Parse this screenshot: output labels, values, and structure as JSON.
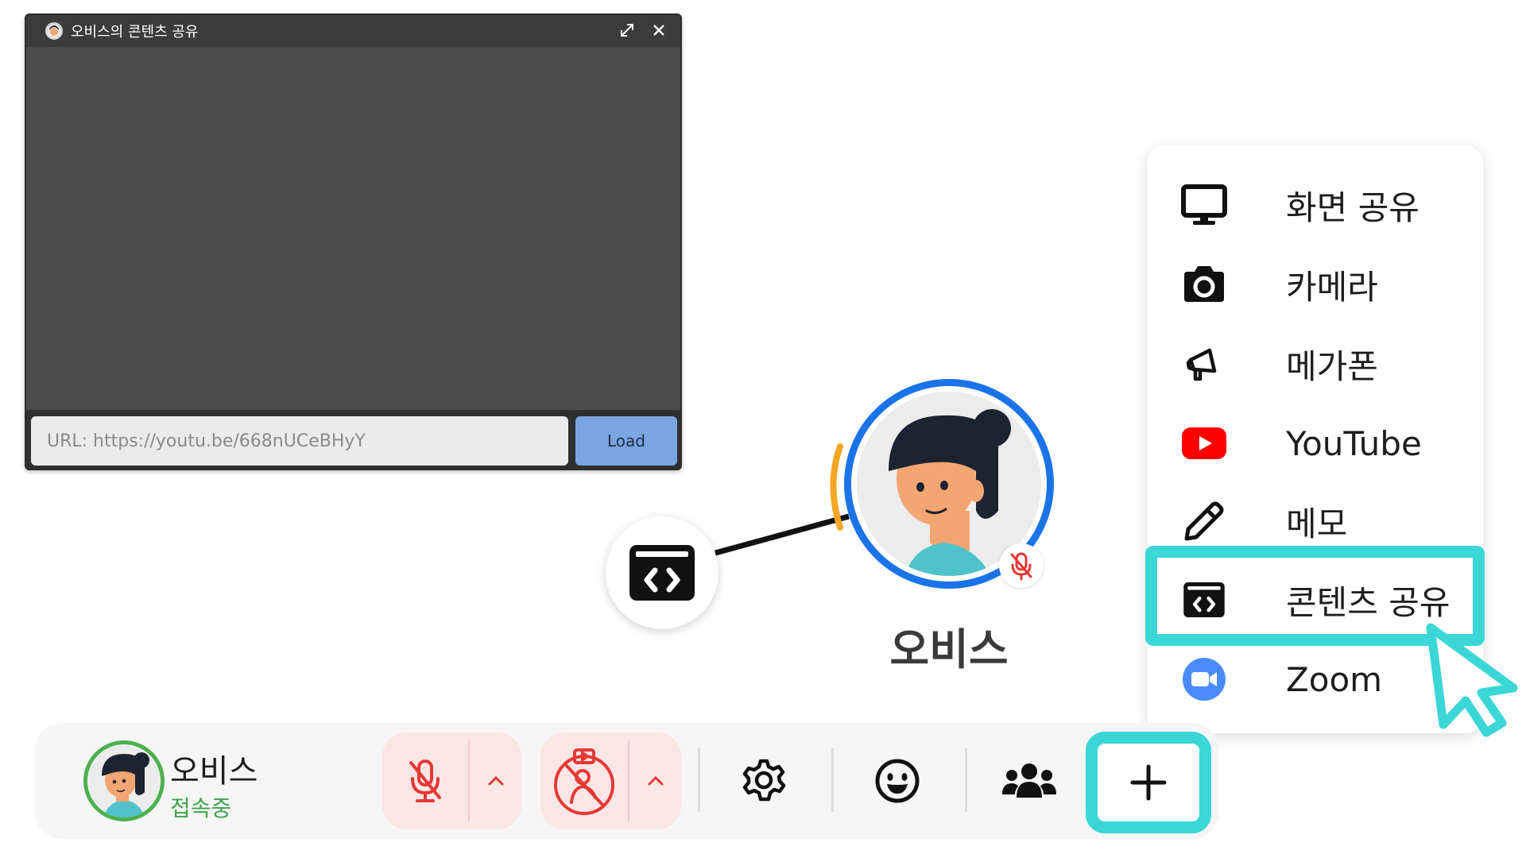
{
  "share_window": {
    "title": "오비스의 콘텐츠 공유",
    "url_value": "URL: https://youtu.be/668nUCeBHyY",
    "load_label": "Load",
    "icons": [
      "expand-icon",
      "close-icon"
    ]
  },
  "center": {
    "user_name": "오비스",
    "node_icon": "content-share-icon",
    "badge_icon": "mic-muted-icon",
    "ring_color": "#1a73e8",
    "speaking_color": "#f5a623"
  },
  "menu": {
    "items": [
      {
        "label": "화면 공유",
        "icon": "monitor-icon"
      },
      {
        "label": "카메라",
        "icon": "camera-icon"
      },
      {
        "label": "메가폰",
        "icon": "megaphone-icon"
      },
      {
        "label": "YouTube",
        "icon": "youtube-icon"
      },
      {
        "label": "메모",
        "icon": "pencil-icon"
      },
      {
        "label": "콘텐츠 공유",
        "icon": "content-share-icon"
      },
      {
        "label": "Zoom",
        "icon": "zoom-icon"
      }
    ],
    "highlight_color": "#3bd6d6"
  },
  "toolbar": {
    "user_name": "오비스",
    "status": "접속중",
    "status_color": "#3fa34d",
    "buttons": [
      "mic-muted-icon",
      "chevron-up-icon",
      "camera-off-icon",
      "chevron-up-icon",
      "gear-icon",
      "smiley-icon",
      "group-icon",
      "plus-icon"
    ]
  }
}
